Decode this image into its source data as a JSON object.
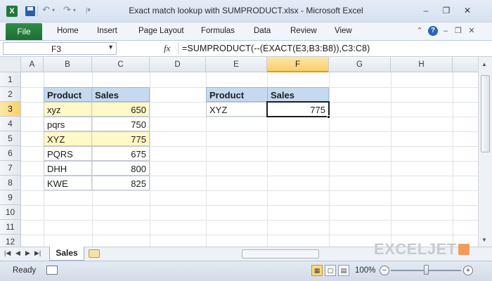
{
  "window": {
    "title": "Exact match lookup with SUMPRODUCT.xlsx  -  Microsoft Excel",
    "app_icon_letter": "X",
    "controls": {
      "minimize": "–",
      "restore": "❐",
      "close": "✕"
    }
  },
  "ribbon": {
    "file_tab": "File",
    "tabs": [
      "Home",
      "Insert",
      "Page Layout",
      "Formulas",
      "Data",
      "Review",
      "View"
    ]
  },
  "formula_bar": {
    "name_box": "F3",
    "fx": "fx",
    "formula": "=SUMPRODUCT(--(EXACT(E3,B3:B8)),C3:C8)"
  },
  "grid": {
    "columns": [
      "A",
      "B",
      "C",
      "D",
      "E",
      "F",
      "G",
      "H"
    ],
    "rows": [
      "1",
      "2",
      "3",
      "4",
      "5",
      "6",
      "7",
      "8",
      "9",
      "10",
      "11",
      "12"
    ],
    "selected_column": "F",
    "selected_row": "3"
  },
  "data_table": {
    "headers": [
      "Product",
      "Sales"
    ],
    "rows": [
      {
        "product": "xyz",
        "sales": "650",
        "highlight": true
      },
      {
        "product": "pqrs",
        "sales": "750",
        "highlight": false
      },
      {
        "product": "XYZ",
        "sales": "775",
        "highlight": true
      },
      {
        "product": "PQRS",
        "sales": "675",
        "highlight": false
      },
      {
        "product": "DHH",
        "sales": "800",
        "highlight": false
      },
      {
        "product": "KWE",
        "sales": "825",
        "highlight": false
      }
    ],
    "highlight_color": "#fff8c7",
    "header_color": "#c6d9f1"
  },
  "lookup_table": {
    "headers": [
      "Product",
      "Sales"
    ],
    "product": "XYZ",
    "sales": "775"
  },
  "sheet_tabs": {
    "active": "Sales",
    "brand": "EXCELJET"
  },
  "status_bar": {
    "status": "Ready",
    "zoom": "100%",
    "zoom_out": "−",
    "zoom_in": "+"
  }
}
